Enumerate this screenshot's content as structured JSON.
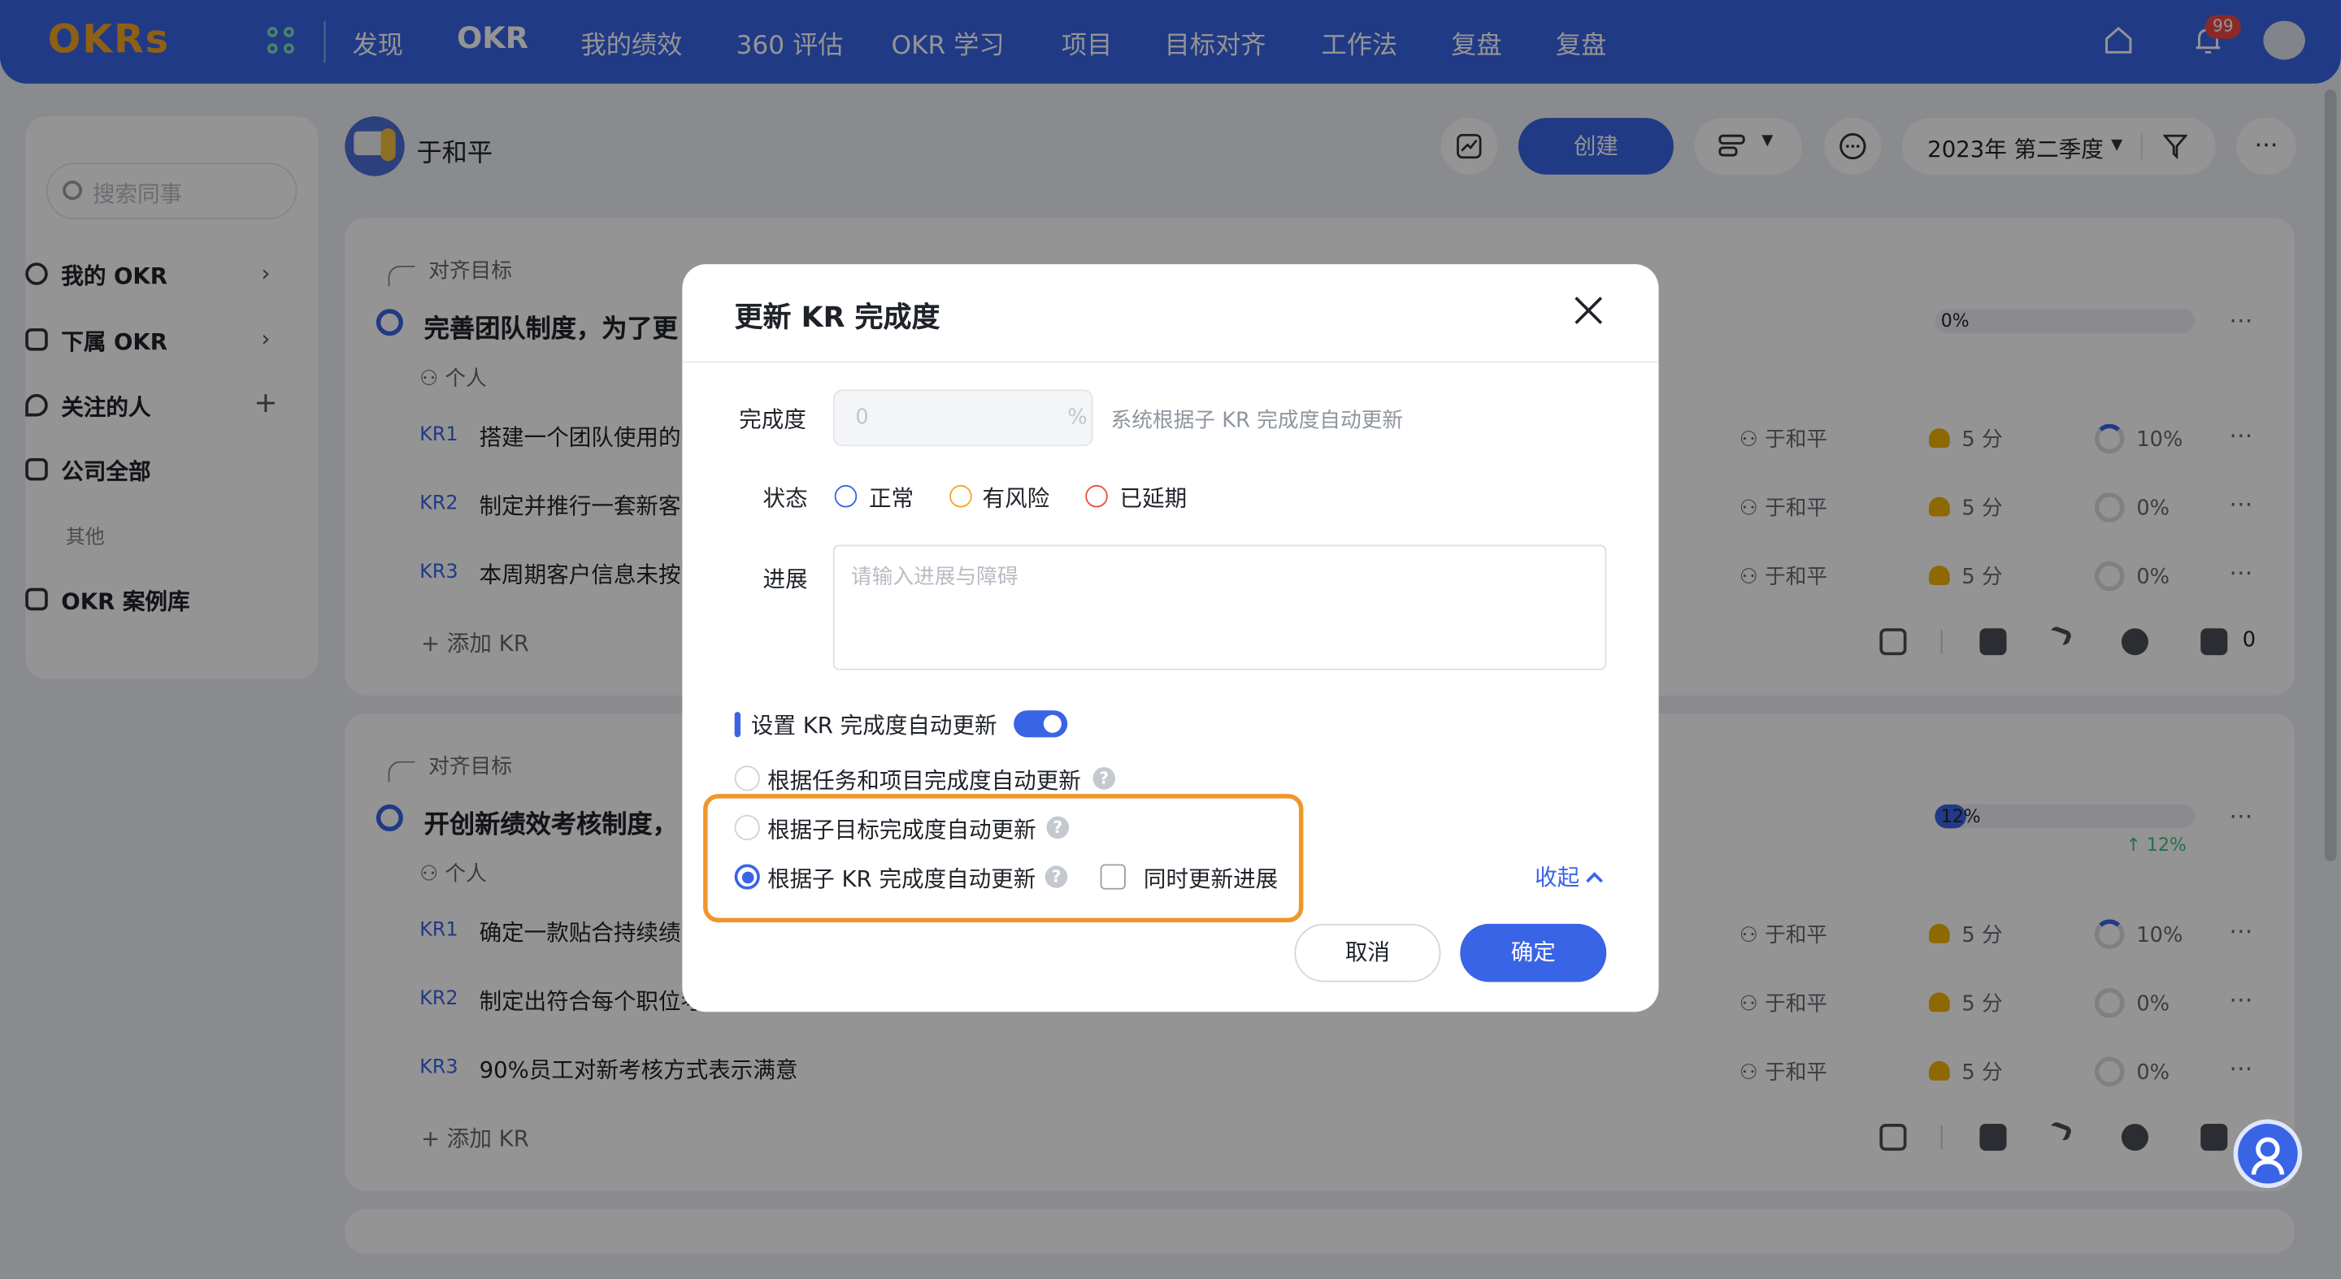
{
  "logo": "OKRs",
  "nav": {
    "items": [
      "发现",
      "OKR",
      "我的绩效",
      "360 评估",
      "OKR 学习",
      "项目",
      "目标对齐",
      "工作法",
      "复盘",
      "复盘"
    ],
    "notification_count": "99"
  },
  "sidebar": {
    "search_placeholder": "搜索同事",
    "items": [
      {
        "label": "我的 OKR",
        "icon": "target-icon"
      },
      {
        "label": "下属 OKR",
        "icon": "hierarchy-icon"
      },
      {
        "label": "关注的人",
        "icon": "heart-icon"
      },
      {
        "label": "公司全部",
        "icon": "building-icon"
      }
    ],
    "other_label": "其他",
    "case_library": "OKR 案例库"
  },
  "header": {
    "user_name": "于和平",
    "create_label": "创建",
    "quarter": "2023年 第二季度"
  },
  "objectives": [
    {
      "align_label": "对齐目标",
      "title": "完善团队制度，为了更",
      "scope": "个人",
      "progress": "0%",
      "progress_value": 0,
      "krs": [
        {
          "tag": "KR1",
          "text": "搭建一个团队使用的",
          "owner": "于和平",
          "score": "5 分",
          "progress": "10%"
        },
        {
          "tag": "KR2",
          "text": "制定并推行一套新客",
          "owner": "于和平",
          "score": "5 分",
          "progress": "0%"
        },
        {
          "tag": "KR3",
          "text": "本周期客户信息未按",
          "owner": "于和平",
          "score": "5 分",
          "progress": "0%"
        }
      ],
      "add_kr": "添加 KR",
      "likes": "0"
    },
    {
      "align_label": "对齐目标",
      "title": "开创新绩效考核制度，",
      "scope": "个人",
      "progress": "12%",
      "progress_value": 12,
      "delta": "↑ 12%",
      "krs": [
        {
          "tag": "KR1",
          "text": "确定一款贴合持续绩",
          "owner": "于和平",
          "score": "5 分",
          "progress": "10%"
        },
        {
          "tag": "KR2",
          "text": "制定出符合每个职位考",
          "owner": "于和平",
          "score": "5 分",
          "progress": "0%"
        },
        {
          "tag": "KR3",
          "text": "90%员工对新考核方式表示满意",
          "owner": "于和平",
          "score": "5 分",
          "progress": "0%"
        }
      ],
      "add_kr": "添加 KR"
    }
  ],
  "dialog": {
    "title": "更新 KR 完成度",
    "completion_label": "完成度",
    "completion_value": "0",
    "completion_unit": "%",
    "completion_hint": "系统根据子 KR 完成度自动更新",
    "status_label": "状态",
    "status_options": [
      {
        "label": "正常",
        "color": "#3a64e6"
      },
      {
        "label": "有风险",
        "color": "#f5a623"
      },
      {
        "label": "已延期",
        "color": "#e8513d"
      }
    ],
    "progress_label": "进展",
    "progress_placeholder": "请输入进展与障碍",
    "auto_update_label": "设置 KR 完成度自动更新",
    "auto_update_enabled": true,
    "options": [
      {
        "label": "根据任务和项目完成度自动更新",
        "selected": false
      },
      {
        "label": "根据子目标完成度自动更新",
        "selected": false
      },
      {
        "label": "根据子 KR 完成度自动更新",
        "selected": true
      }
    ],
    "sync_progress_label": "同时更新进展",
    "sync_progress_checked": false,
    "collapse_label": "收起",
    "cancel_label": "取消",
    "confirm_label": "确定"
  },
  "colors": {
    "primary": "#3a64e6",
    "highlight": "#f0962a"
  }
}
